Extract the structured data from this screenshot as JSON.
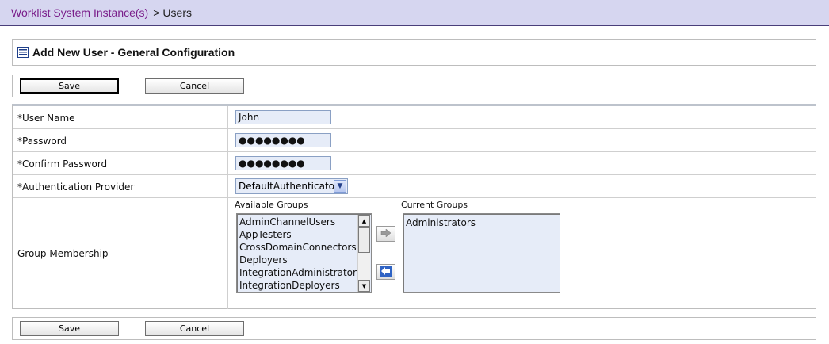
{
  "breadcrumb": {
    "parent_label": "Worklist System Instance(s)",
    "separator": ">",
    "current_label": "Users"
  },
  "page": {
    "title": "Add New User - General Configuration",
    "title_icon": "document-list-icon"
  },
  "toolbar": {
    "save_label": "Save",
    "cancel_label": "Cancel"
  },
  "form": {
    "user_name": {
      "label": "*User Name",
      "value": "John"
    },
    "password": {
      "label": "*Password",
      "value": "●●●●●●●●"
    },
    "confirm_password": {
      "label": "*Confirm Password",
      "value": "●●●●●●●●"
    },
    "auth_provider": {
      "label": "*Authentication Provider",
      "value": "DefaultAuthenticator"
    },
    "group_membership": {
      "label": "Group Membership",
      "available_label": "Available Groups",
      "current_label": "Current Groups",
      "available_groups": [
        "AdminChannelUsers",
        "AppTesters",
        "CrossDomainConnectors",
        "Deployers",
        "IntegrationAdministrators",
        "IntegrationDeployers"
      ],
      "current_groups": [
        "Administrators"
      ],
      "add_icon": "arrow-right-icon",
      "remove_icon": "arrow-left-icon"
    }
  },
  "colors": {
    "header_bg": "#d6d6f0",
    "link": "#7a1e8a",
    "input_bg": "#e6ecf8"
  }
}
